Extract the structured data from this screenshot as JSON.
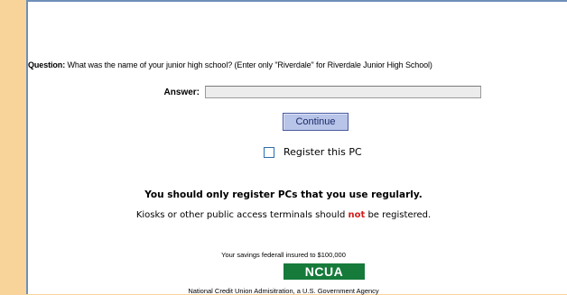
{
  "question": {
    "label": "Question:",
    "text": "What was the name of your junior high school? (Enter only \"Riverdale\" for Riverdale Junior High School)"
  },
  "answer": {
    "label": "Answer:",
    "value": ""
  },
  "continue_label": "Continue",
  "register": {
    "label": "Register this PC",
    "checked": false
  },
  "warnings": {
    "line1": "You should only register PCs that you use regularly.",
    "line2_before": "Kiosks or other public access terminals should ",
    "line2_emphasis": "not",
    "line2_after": " be registered."
  },
  "footer": {
    "savings": "Your savings federall insured to $100,000",
    "logo_text": "NCUA",
    "agency": "National Credit Union Admisitration, a U.S. Government Agency"
  },
  "colors": {
    "page_background": "#f9d49a",
    "button_fill": "#b8c4e8",
    "emphasis_red": "#d0201c",
    "ncua_green": "#157a3a"
  }
}
